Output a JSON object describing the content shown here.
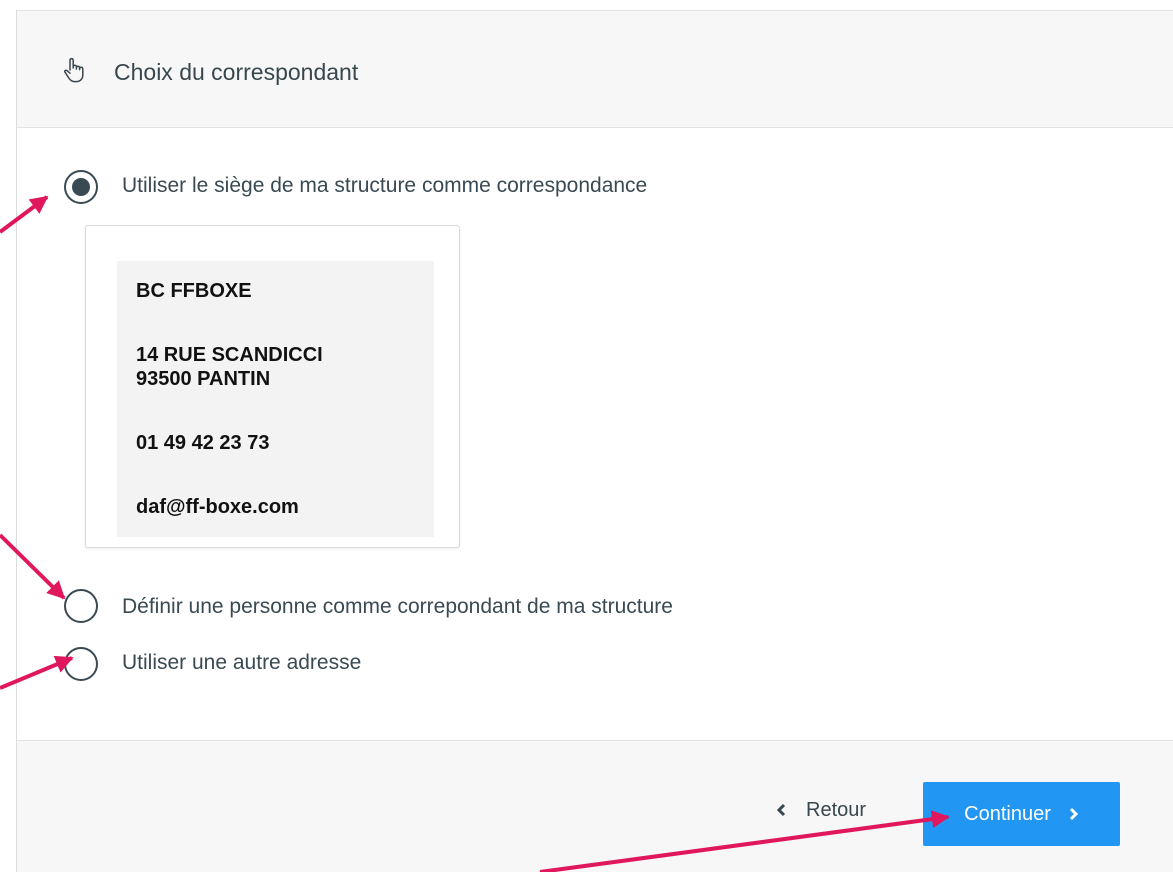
{
  "header": {
    "title": "Choix du correspondant",
    "icon": "hand-pointer-icon"
  },
  "options": [
    {
      "label": "Utiliser le siège de ma structure comme correspondance",
      "selected": true
    },
    {
      "label": "Définir une personne comme correpondant de ma structure",
      "selected": false
    },
    {
      "label": "Utiliser une autre adresse",
      "selected": false
    }
  ],
  "address": {
    "name": "BC FFBOXE",
    "street": "14 RUE SCANDICCI",
    "city": "93500 PANTIN",
    "phone": "01 49 42 23 73",
    "email": "daf@ff-boxe.com"
  },
  "footer": {
    "back_label": "Retour",
    "continue_label": "Continuer"
  },
  "colors": {
    "accent": "#2196f3",
    "annotation_arrow": "#e0175d",
    "text": "#37474f"
  }
}
